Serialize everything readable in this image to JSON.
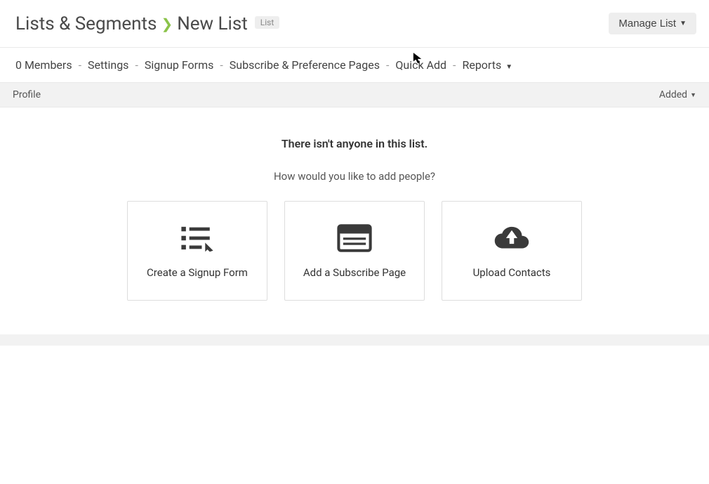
{
  "header": {
    "breadcrumb_root": "Lists & Segments",
    "breadcrumb_current": "New List",
    "tag": "List",
    "manage_button": "Manage List"
  },
  "subnav": {
    "items": [
      "0 Members",
      "Settings",
      "Signup Forms",
      "Subscribe & Preference Pages",
      "Quick Add",
      "Reports"
    ]
  },
  "columns": {
    "left": "Profile",
    "right": "Added"
  },
  "empty": {
    "title": "There isn't anyone in this list.",
    "subtitle": "How would you like to add people?",
    "cards": [
      {
        "label": "Create a Signup Form"
      },
      {
        "label": "Add a Subscribe Page"
      },
      {
        "label": "Upload Contacts"
      }
    ]
  }
}
